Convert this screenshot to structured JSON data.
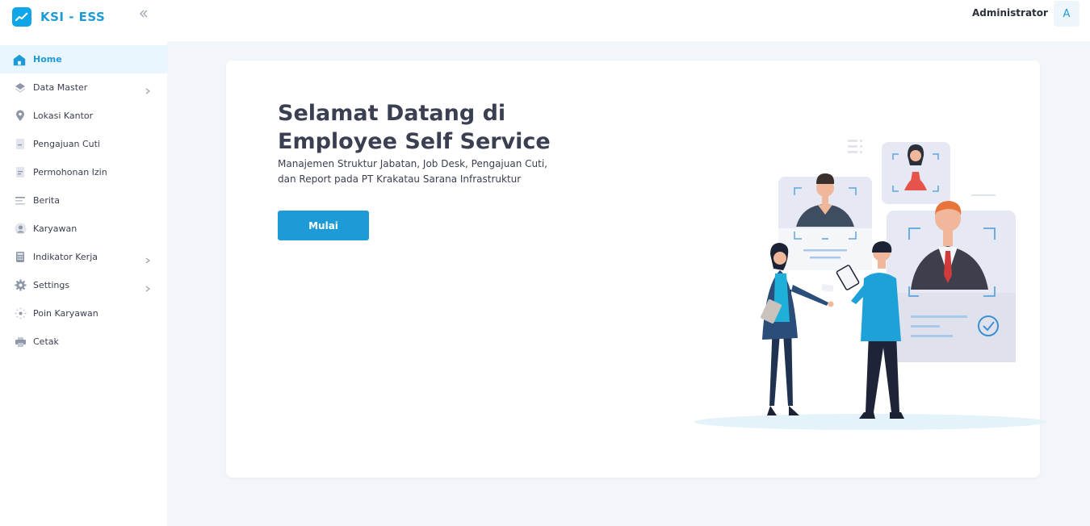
{
  "brand": {
    "name": "KSI - ESS"
  },
  "header": {
    "user_name": "Administrator",
    "avatar_letter": "A"
  },
  "sidebar": {
    "items": [
      {
        "label": "Home",
        "icon": "home-icon",
        "active": true
      },
      {
        "label": "Data Master",
        "icon": "layers-icon",
        "has_submenu": true
      },
      {
        "label": "Lokasi Kantor",
        "icon": "location-pin-icon"
      },
      {
        "label": "Pengajuan Cuti",
        "icon": "document-icon"
      },
      {
        "label": "Permohonan Izin",
        "icon": "document-lines-icon"
      },
      {
        "label": "Berita",
        "icon": "news-lines-icon"
      },
      {
        "label": "Karyawan",
        "icon": "user-icon"
      },
      {
        "label": "Indikator Kerja",
        "icon": "calculator-icon",
        "has_submenu": true
      },
      {
        "label": "Settings",
        "icon": "gear-icon",
        "has_submenu": true
      },
      {
        "label": "Poin Karyawan",
        "icon": "sparkle-icon"
      },
      {
        "label": "Cetak",
        "icon": "printer-icon"
      }
    ]
  },
  "hero": {
    "title": "Selamat Datang di Employee Self Service",
    "description": "Manajemen Struktur Jabatan, Job Desk, Pengajuan Cuti, dan Report pada PT Krakatau Sarana Infrastruktur",
    "cta_label": "Mulai"
  },
  "colors": {
    "accent": "#1d9bd6",
    "page_bg": "#f2f5f9",
    "text": "#3a3f51"
  }
}
